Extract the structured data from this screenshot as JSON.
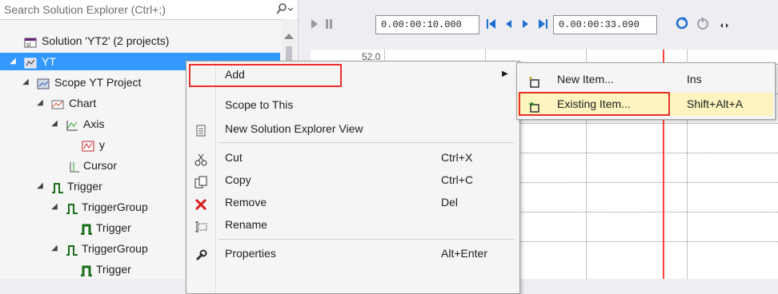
{
  "explorer": {
    "search_placeholder": "Search Solution Explorer (Ctrl+;)",
    "tree": [
      {
        "label": "Solution 'YT2' (2 projects)",
        "icon": "solution-icon"
      },
      {
        "label": "YT",
        "icon": "project-icon",
        "selected": true
      },
      {
        "label": "Scope YT Project",
        "icon": "scope-project-icon"
      },
      {
        "label": "Chart",
        "icon": "chart-icon"
      },
      {
        "label": "Axis",
        "icon": "axis-icon"
      },
      {
        "label": "y",
        "icon": "channel-icon"
      },
      {
        "label": "Cursor",
        "icon": "cursor-icon"
      },
      {
        "label": "Trigger",
        "icon": "trigger-icon"
      },
      {
        "label": "TriggerGroup",
        "icon": "trigger-group-icon"
      },
      {
        "label": "Trigger",
        "icon": "trigger-item-icon"
      },
      {
        "label": "TriggerGroup",
        "icon": "trigger-group-icon"
      },
      {
        "label": "Trigger",
        "icon": "trigger-item-icon"
      }
    ]
  },
  "toolbar": {
    "time_start": "0.00:00:10.000",
    "time_end": "0.00:00:33.090"
  },
  "chart": {
    "y_value_label": "52.0"
  },
  "context_menu": {
    "items": [
      {
        "label": "Add",
        "shortcut": "",
        "has_submenu": true
      },
      {
        "label": "Scope to This",
        "shortcut": ""
      },
      {
        "label": "New Solution Explorer View",
        "shortcut": ""
      },
      {
        "label": "Cut",
        "shortcut": "Ctrl+X"
      },
      {
        "label": "Copy",
        "shortcut": "Ctrl+C"
      },
      {
        "label": "Remove",
        "shortcut": "Del"
      },
      {
        "label": "Rename",
        "shortcut": ""
      },
      {
        "label": "Properties",
        "shortcut": "Alt+Enter"
      }
    ]
  },
  "submenu": {
    "items": [
      {
        "label": "New Item...",
        "shortcut": "Ins"
      },
      {
        "label": "Existing Item...",
        "shortcut": "Shift+Alt+A"
      }
    ]
  },
  "colors": {
    "selection": "#3399ff",
    "highlight_box": "#e8302a",
    "menu_hover": "#fdf4bf",
    "cursor_line": "#ff4040"
  }
}
